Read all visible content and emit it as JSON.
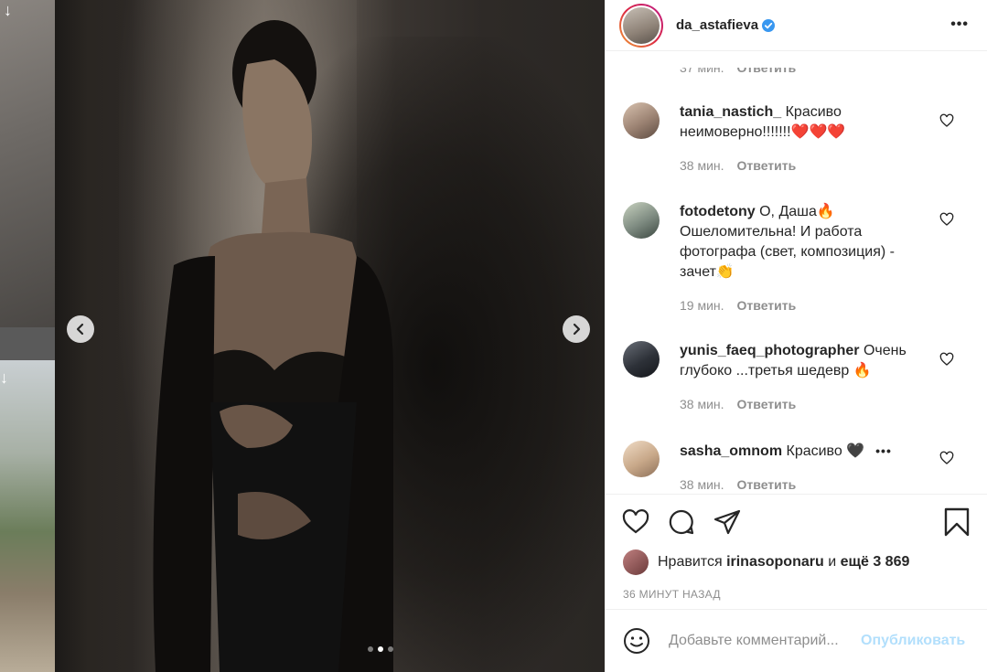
{
  "post": {
    "username": "da_astafieva",
    "more_label": "•••",
    "carousel_dots": 3,
    "carousel_active": 1
  },
  "partial_comment": {
    "time": "37 мин.",
    "reply": "Ответить"
  },
  "comments": [
    {
      "username": "tania_nastich_",
      "text": "Красиво неимоверно!!!!!!!❤️❤️❤️",
      "time": "38 мин.",
      "reply": "Ответить"
    },
    {
      "username": "fotodetony",
      "text": "О, Даша🔥 Ошеломительна! И работа фотографа (свет, композиция) - зачет👏",
      "time": "19 мин.",
      "reply": "Ответить"
    },
    {
      "username": "yunis_faeq_photographer",
      "text": "Очень глубоко ...третья шедевр 🔥",
      "time": "38 мин.",
      "reply": "Ответить"
    },
    {
      "username": "sasha_omnom",
      "text": "Красиво 🖤",
      "time": "38 мин.",
      "reply": "Ответить"
    }
  ],
  "likes": {
    "prefix": "Нравится",
    "user": "irinasoponaru",
    "conj": "и",
    "rest": "ещё 3 869"
  },
  "timestamp": "36 МИНУТ НАЗАД",
  "add_comment": {
    "placeholder": "Добавьте комментарий...",
    "publish_label": "Опубликовать"
  },
  "colors": {
    "verified": "#3897f0",
    "publish_disabled": "#b2dffc",
    "meta": "#8e8e8e",
    "text": "#262626"
  }
}
